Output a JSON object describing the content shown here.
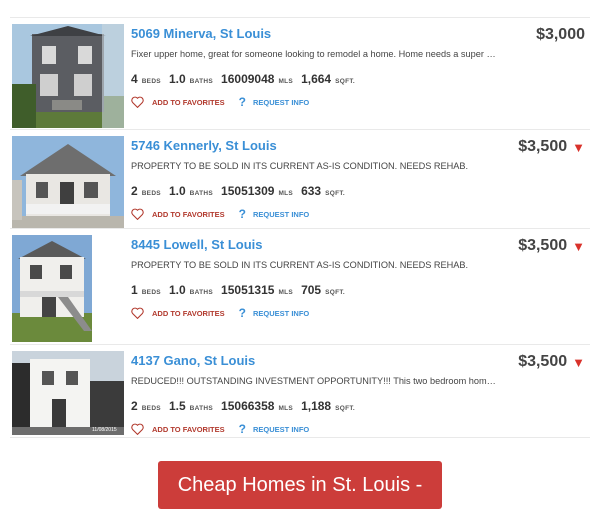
{
  "listings": [
    {
      "address": "5069 Minerva, St Louis",
      "price": "$3,000",
      "price_reduced": false,
      "description": "Fixer upper home, great for someone looking to remodel a home. Home needs a super cle…",
      "beds": "4",
      "beds_label": "BEDS",
      "baths": "1.0",
      "baths_label": "BATHS",
      "mls": "16009048",
      "mls_label": "MLS",
      "sqft": "1,664",
      "sqft_label": "SQFT.",
      "favorite_label": "ADD TO FAVORITES",
      "request_label": "REQUEST INFO"
    },
    {
      "address": "5746 Kennerly, St Louis",
      "price": "$3,500",
      "price_reduced": true,
      "description": "PROPERTY TO BE SOLD IN ITS CURRENT AS-IS CONDITION. NEEDS REHAB.",
      "beds": "2",
      "beds_label": "BEDS",
      "baths": "1.0",
      "baths_label": "BATHS",
      "mls": "15051309",
      "mls_label": "MLS",
      "sqft": "633",
      "sqft_label": "SQFT.",
      "favorite_label": "ADD TO FAVORITES",
      "request_label": "REQUEST INFO"
    },
    {
      "address": "8445 Lowell, St Louis",
      "price": "$3,500",
      "price_reduced": true,
      "description": "PROPERTY TO BE SOLD IN ITS CURRENT AS-IS CONDITION. NEEDS REHAB.",
      "beds": "1",
      "beds_label": "BEDS",
      "baths": "1.0",
      "baths_label": "BATHS",
      "mls": "15051315",
      "mls_label": "MLS",
      "sqft": "705",
      "sqft_label": "SQFT.",
      "favorite_label": "ADD TO FAVORITES",
      "request_label": "REQUEST INFO"
    },
    {
      "address": "4137 Gano, St Louis",
      "price": "$3,500",
      "price_reduced": true,
      "description": "REDUCED!!! OUTSTANDING INVESTMENT OPPORTUNITY!!! This two bedroom home is ju…",
      "beds": "2",
      "beds_label": "BEDS",
      "baths": "1.5",
      "baths_label": "BATHS",
      "mls": "15066358",
      "mls_label": "MLS",
      "sqft": "1,188",
      "sqft_label": "SQFT.",
      "favorite_label": "ADD TO FAVORITES",
      "request_label": "REQUEST INFO",
      "photo_stamp": "11/08/2015"
    }
  ],
  "cta": {
    "label": "Cheap Homes in St. Louis -"
  },
  "colors": {
    "link": "#3a8fd6",
    "favorite": "#b23a2e",
    "price_drop_arrow": "#d9322b",
    "cta_background": "#cc3d3a"
  },
  "icons": {
    "favorite": "heart-outline-icon",
    "request": "question-mark-icon",
    "price_drop": "down-triangle-icon"
  }
}
